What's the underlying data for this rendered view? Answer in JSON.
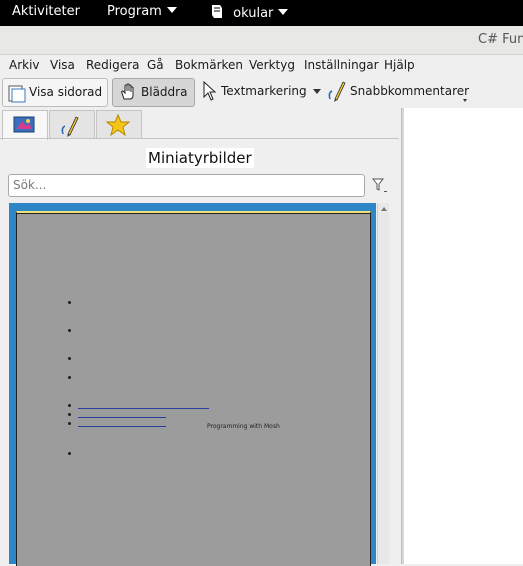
{
  "top_panel": {
    "activities": "Aktiviteter",
    "program": "Program",
    "app_name": "okular"
  },
  "window": {
    "title": "C# Fund"
  },
  "menubar": {
    "items": [
      "Arkiv",
      "Visa",
      "Redigera",
      "Gå",
      "Bokmärken",
      "Verktyg",
      "Inställningar",
      "Hjälp"
    ]
  },
  "toolbar": {
    "single_page": "Visa sidorad",
    "browse": "Bläddra",
    "text_select": "Textmarkering",
    "quick_annotations": "Snabbkommentarer"
  },
  "sidebar": {
    "panel_title": "Miniatyrbilder",
    "search_placeholder": "Sök...",
    "thumbnail_text": "Programming with Mosh"
  },
  "colors": {
    "thumb_frame": "#2f86c6",
    "page_bg": "#9c9c9c"
  }
}
